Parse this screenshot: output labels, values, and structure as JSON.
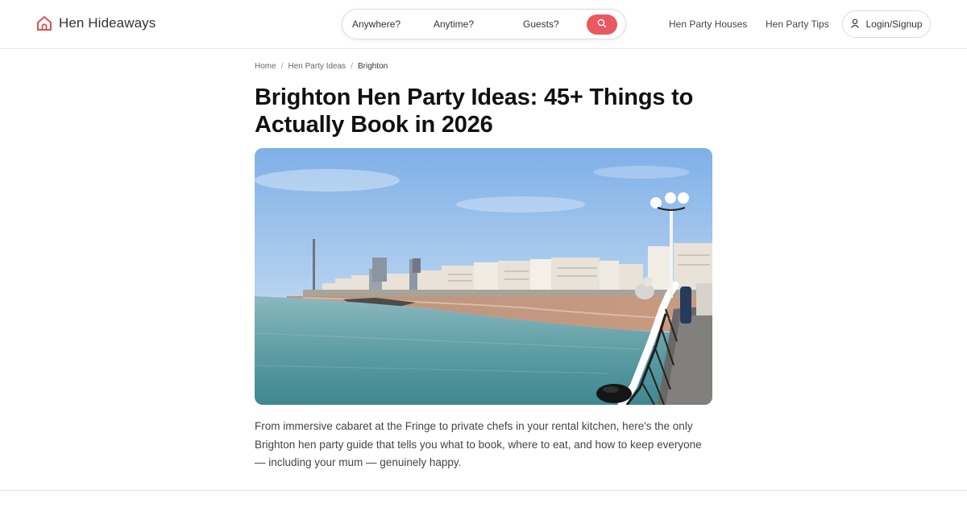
{
  "header": {
    "brand": "Hen Hideaways",
    "search": {
      "where": "Anywhere?",
      "when": "Anytime?",
      "guests": "Guests?"
    },
    "nav": {
      "houses": "Hen Party Houses",
      "tips": "Hen Party Tips",
      "login": "Login/Signup"
    }
  },
  "breadcrumb": {
    "home": "Home",
    "ideas": "Hen Party Ideas",
    "current": "Brighton",
    "separator": "/"
  },
  "article": {
    "title_line1": "Brighton Hen Party Ideas: 45+ Things to",
    "title_line2": "Actually Book in 2026",
    "intro": "From immersive cabaret at the Fringe to private chefs in your rental kitchen, here's the only Brighton hen party guide that tells you what to book, where to eat, and how to keep everyone — including your mum — genuinely happy."
  },
  "colors": {
    "accent": "#e85a5f",
    "logo": "#d9534f"
  }
}
